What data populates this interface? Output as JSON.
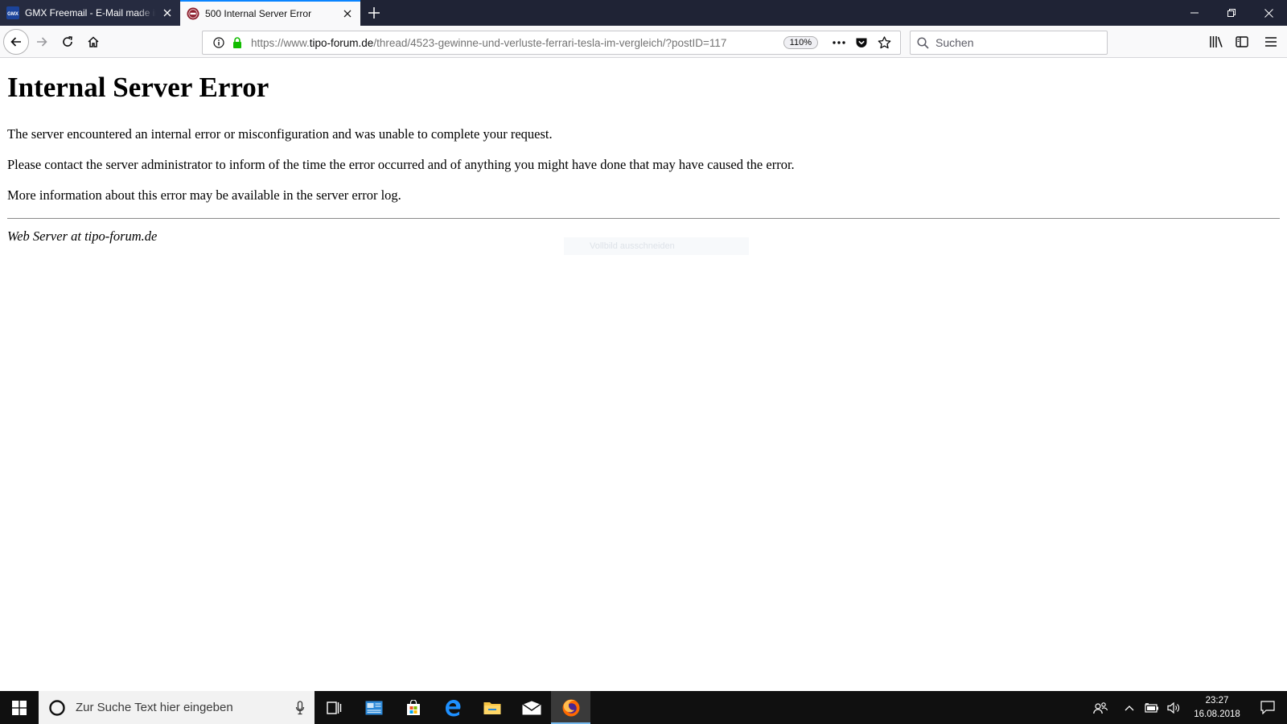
{
  "browser": {
    "tabs": [
      {
        "title": "GMX Freemail - E-Mail made in Germany",
        "favicon_text": "GMX",
        "active": false
      },
      {
        "title": "500 Internal Server Error",
        "active": true
      }
    ],
    "url": {
      "scheme": "https://www.",
      "host": "tipo-forum.de",
      "path": "/thread/4523-gewinne-und-verluste-ferrari-tesla-im-vergleich/?postID=117"
    },
    "zoom": "110%",
    "search_placeholder": "Suchen"
  },
  "page": {
    "heading": "Internal Server Error",
    "paragraphs": [
      "The server encountered an internal error or misconfiguration and was unable to complete your request.",
      "Please contact the server administrator to inform of the time the error occurred and of anything you might have done that may have caused the error.",
      "More information about this error may be available in the server error log."
    ],
    "footer": "Web Server at tipo-forum.de",
    "ghost_tooltip": "Vollbild ausschneiden"
  },
  "taskbar": {
    "search_placeholder": "Zur Suche Text hier eingeben",
    "clock_time": "23:27",
    "clock_date": "16.08.2018"
  },
  "colors": {
    "tabstrip": "#1f2335",
    "active_tab_accent": "#0a84ff",
    "secure_lock": "#12bc00",
    "taskbar": "#101010"
  }
}
